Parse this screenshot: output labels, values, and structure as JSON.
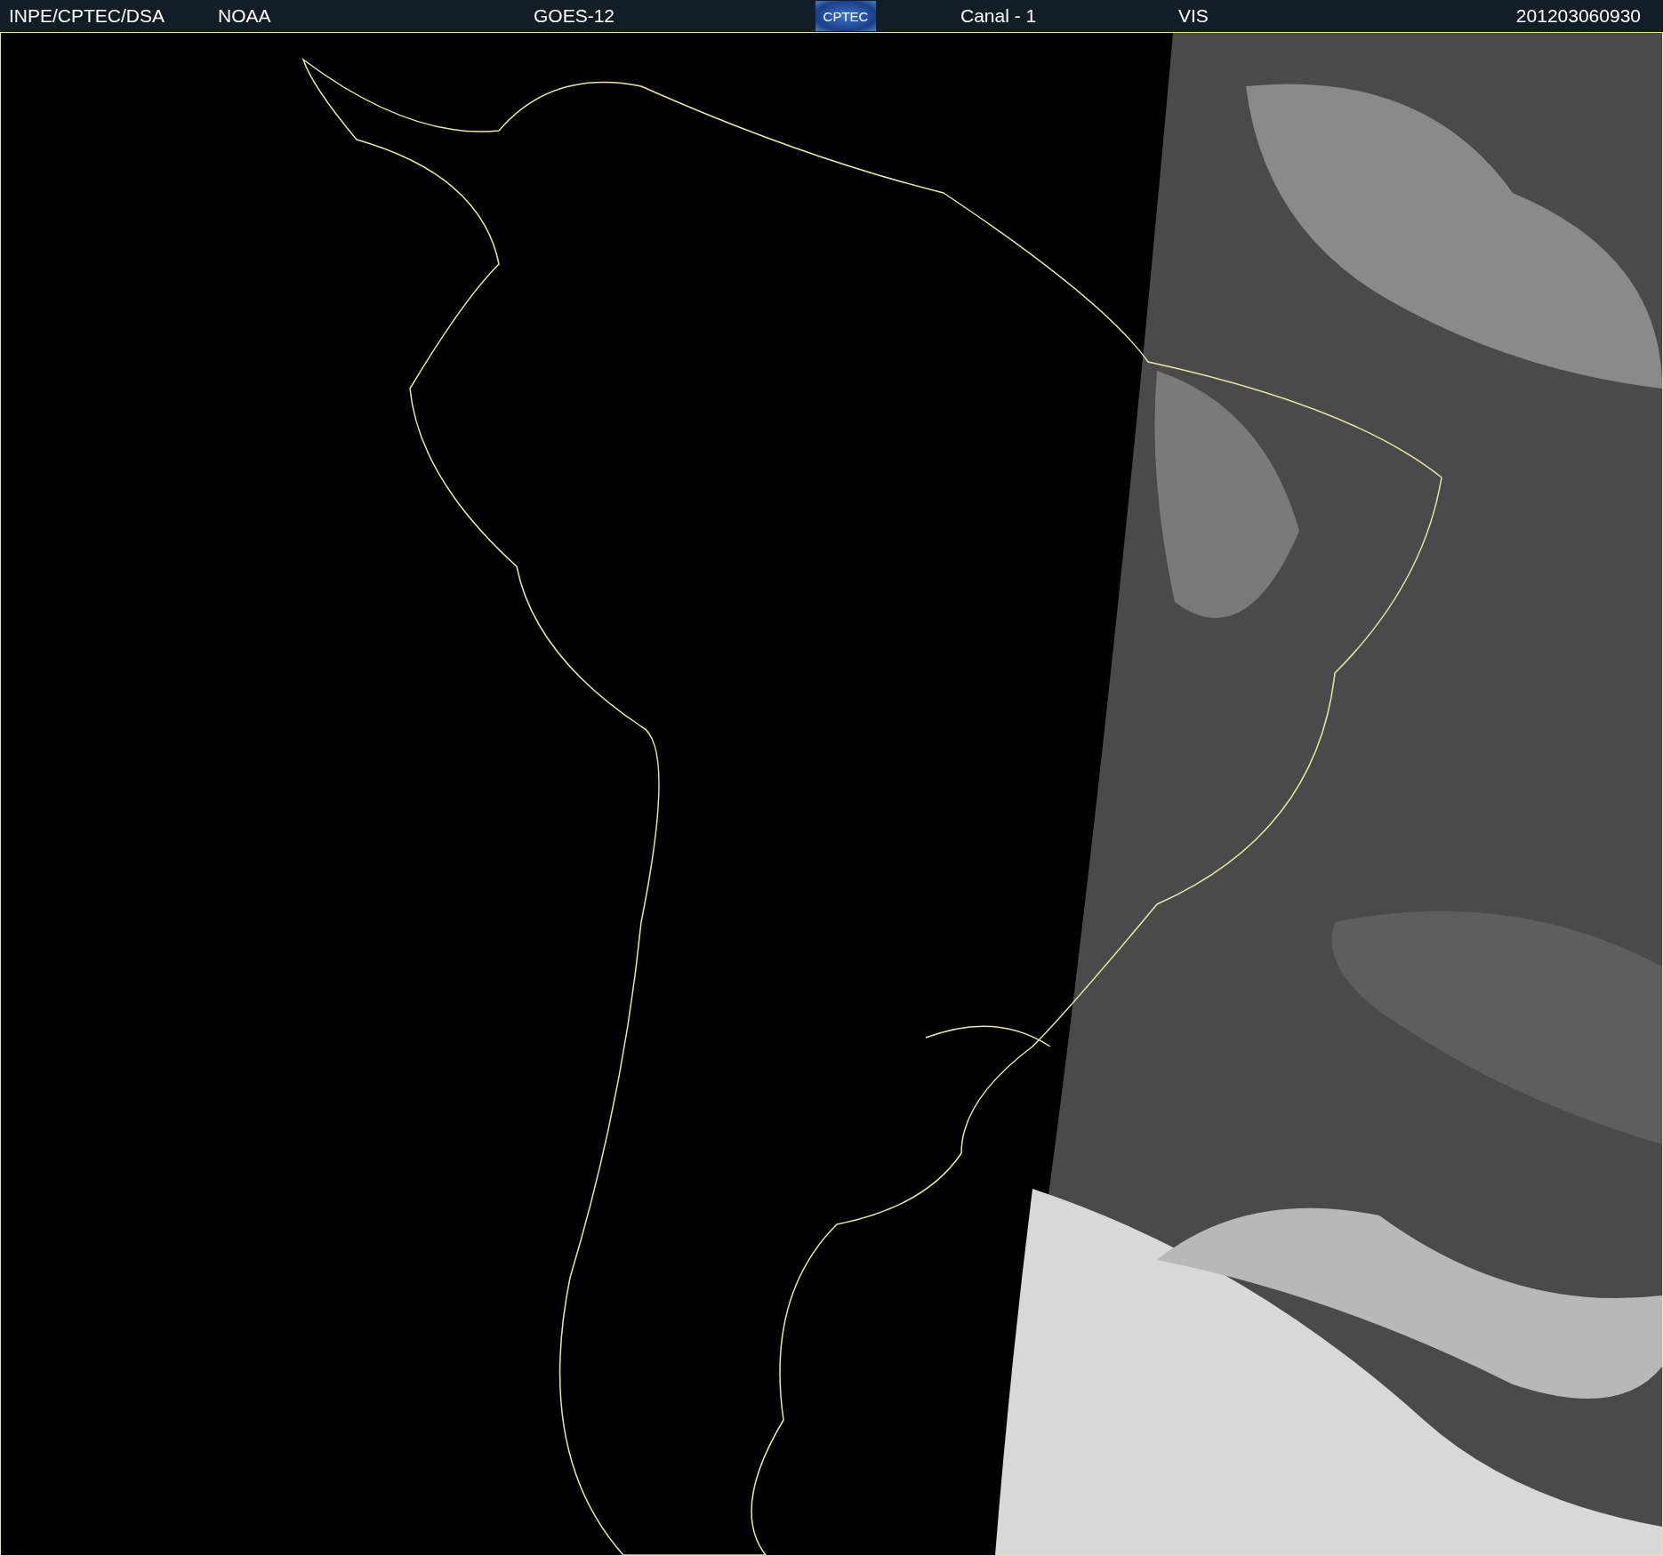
{
  "header": {
    "source": "INPE/CPTEC/DSA",
    "agency": "NOAA",
    "satellite": "GOES-12",
    "logo": "CPTEC",
    "channel": "Canal - 1",
    "band": "VIS",
    "timestamp": "201203060930"
  }
}
